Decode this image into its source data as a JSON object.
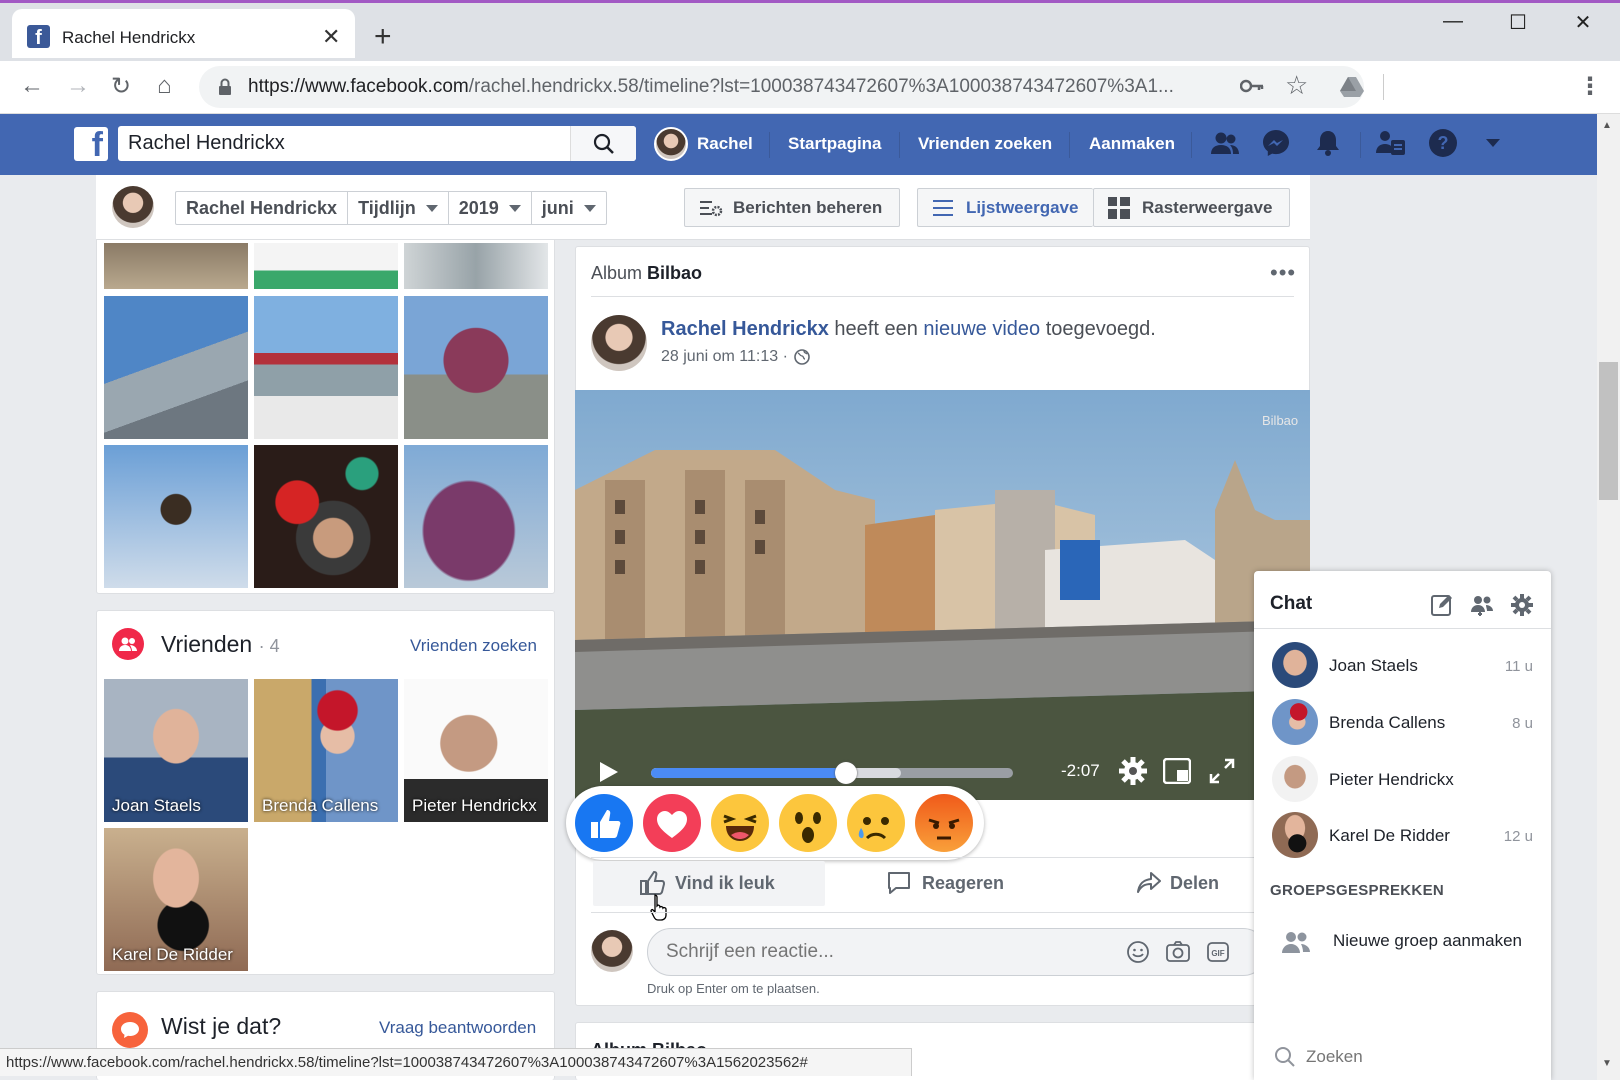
{
  "browser": {
    "tab_title": "Rachel Hendrickx",
    "tab_close": "✕",
    "new_tab": "+",
    "url_host": "https://www.facebook.com",
    "url_path": "/rachel.hendrickx.58/timeline?lst=100038743472607%3A100038743472607%3A1...",
    "status_url": "https://www.facebook.com/rachel.hendrickx.58/timeline?lst=100038743472607%3A100038743472607%3A1562023562#"
  },
  "fb_nav": {
    "search_value": "Rachel Hendrickx",
    "profile_name": "Rachel",
    "home": "Startpagina",
    "find_friends": "Vrienden zoeken",
    "create": "Aanmaken"
  },
  "subheader": {
    "name": "Rachel Hendrickx",
    "timeline": "Tijdlijn",
    "year": "2019",
    "month": "juni",
    "manage_posts": "Berichten beheren",
    "list_view": "Lijstweergave",
    "grid_view": "Rasterweergave"
  },
  "friends": {
    "title": "Vrienden",
    "count": "· 4",
    "find_link": "Vrienden zoeken",
    "list": [
      "Joan Staels",
      "Brenda Callens",
      "Pieter Hendrickx",
      "Karel De Ridder"
    ]
  },
  "did_you_know": {
    "title": "Wist je dat?",
    "link": "Vraag beantwoorden"
  },
  "post": {
    "album_prefix": "Album",
    "album_name": "Bilbao",
    "author": "Rachel Hendrickx",
    "action_1": "heeft een",
    "action_link": "nieuwe video",
    "action_2": "toegevoegd.",
    "date": "28 juni om 11:13 ·",
    "video_watermark": "Bilbao",
    "video_time": "-2:07",
    "video_progress": 0.54,
    "video_buffered": 0.69,
    "like": "Vind ik leuk",
    "comment": "Reageren",
    "share": "Delen",
    "comment_placeholder": "Schrijf een reactie...",
    "comment_hint": "Druk op Enter om te plaatsen.",
    "next_album": "Album Bilbao"
  },
  "chat": {
    "title": "Chat",
    "contacts": [
      {
        "name": "Joan Staels",
        "time": "11 u"
      },
      {
        "name": "Brenda Callens",
        "time": "8 u"
      },
      {
        "name": "Pieter Hendrickx",
        "time": ""
      },
      {
        "name": "Karel De Ridder",
        "time": "12 u"
      }
    ],
    "groups_header": "GROEPSGESPREKKEN",
    "new_group": "Nieuwe groep aanmaken",
    "search_placeholder": "Zoeken"
  },
  "colors": {
    "fb_blue": "#4267b2",
    "link_blue": "#365899",
    "chrome_tabstrip": "#dee1e6"
  }
}
